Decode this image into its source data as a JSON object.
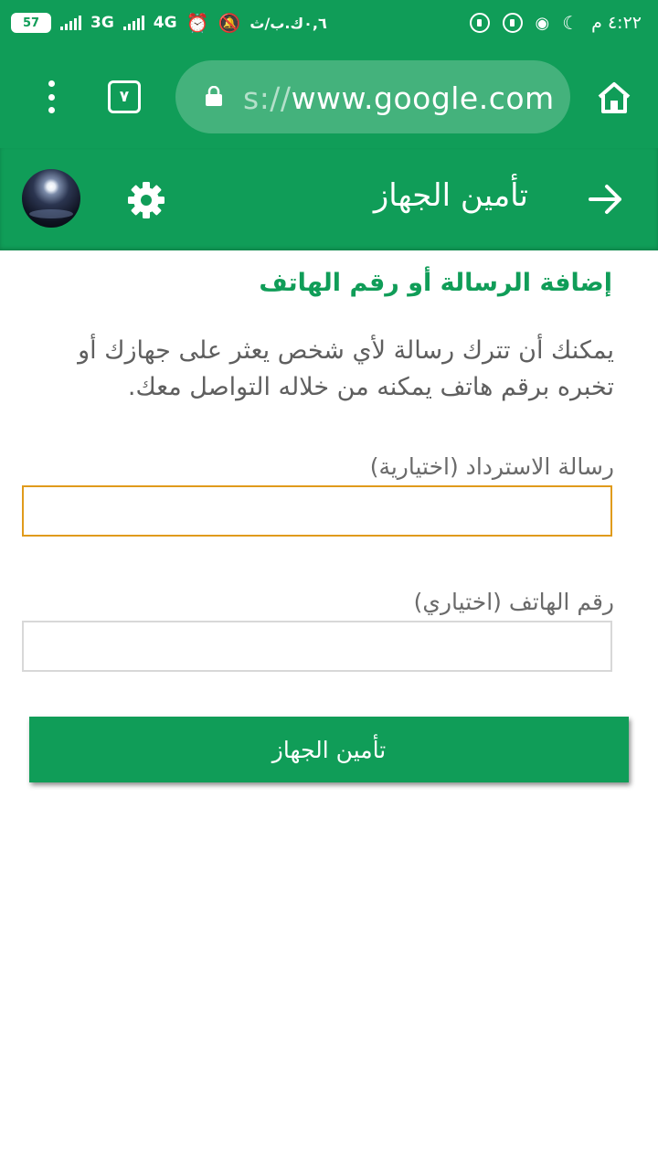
{
  "status_bar": {
    "battery": "57",
    "network_1": "3G",
    "network_2": "4G",
    "carrier_speed": "٠,٦ك.ب/ث",
    "time": "٤:٢٢ م"
  },
  "browser": {
    "tab_count": "٧",
    "url_prefix": "s://",
    "url_host": "www.google.com"
  },
  "header": {
    "title": "تأمين الجهاز"
  },
  "content": {
    "section_heading": "إضافة الرسالة أو رقم الهاتف",
    "description": "يمكنك أن تترك رسالة لأي شخص يعثر على جهازك أو تخبره برقم هاتف يمكنه من خلاله التواصل معك.",
    "recovery_message_label": "رسالة الاسترداد (اختيارية)",
    "recovery_message_value": "",
    "phone_label": "رقم الهاتف (اختياري)",
    "phone_value": "",
    "submit_label": "تأمين الجهاز"
  },
  "colors": {
    "primary": "#109d58",
    "focus_border": "#e09b1c"
  }
}
